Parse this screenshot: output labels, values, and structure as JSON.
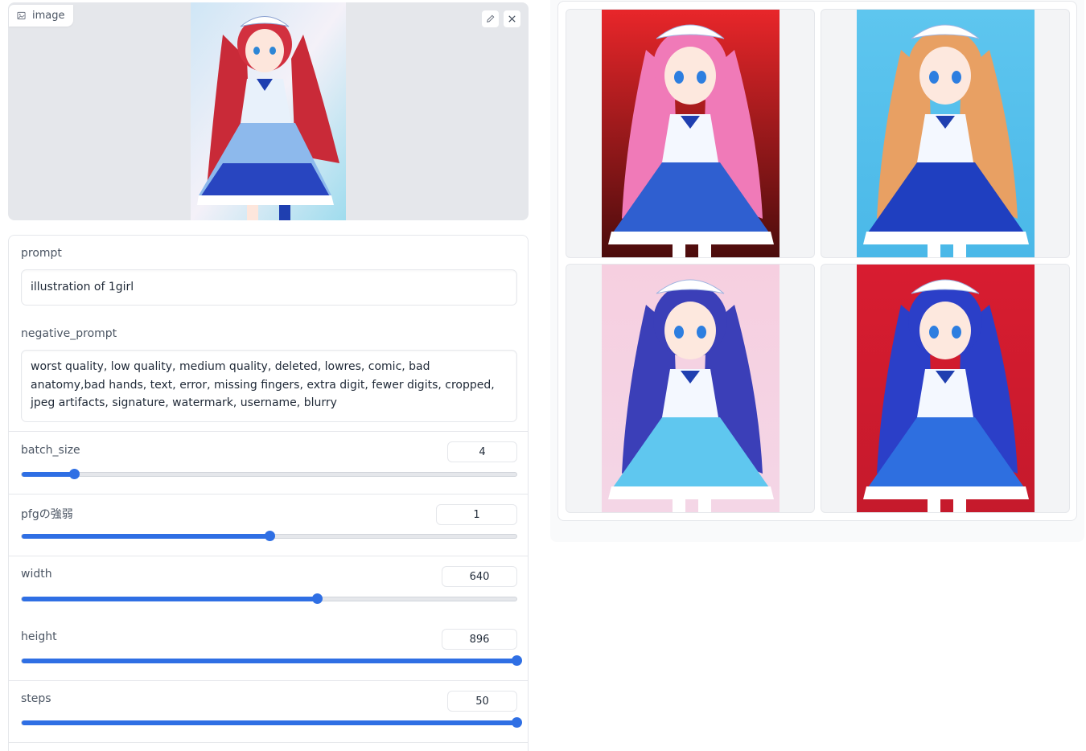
{
  "image_input": {
    "label": "image"
  },
  "form": {
    "prompt": {
      "label": "prompt",
      "value": "illustration of 1girl"
    },
    "negative_prompt": {
      "label": "negative_prompt",
      "value": "worst quality, low quality, medium quality, deleted, lowres, comic, bad anatomy,bad hands, text, error, missing fingers, extra digit, fewer digits, cropped, jpeg artifacts, signature, watermark, username, blurry"
    },
    "sliders": [
      {
        "label": "batch_size",
        "value": "4",
        "fraction": 0.105
      },
      {
        "label": "pfgの強弱",
        "value": "1",
        "fraction": 0.5
      },
      {
        "label": "width",
        "value": "640",
        "fraction": 0.597
      },
      {
        "label": "height",
        "value": "896",
        "fraction": 1.0
      },
      {
        "label": "steps",
        "value": "50",
        "fraction": 1.0
      }
    ]
  },
  "colors": {
    "accent": "#2f6fe4"
  },
  "gallery": {
    "items": [
      {
        "hair": "#f07ab8",
        "bg_top": "#e8262a",
        "bg_bottom": "#4a0c0c",
        "dress": "#2f5fd0"
      },
      {
        "hair": "#e8a063",
        "bg_top": "#5ec6ef",
        "bg_bottom": "#4ab8e8",
        "dress": "#1f3fc0"
      },
      {
        "hair": "#3b3fb8",
        "bg_top": "#f6cfe0",
        "bg_bottom": "#f4d6e6",
        "dress": "#5fc7ef"
      },
      {
        "hair": "#2b3fc8",
        "bg_top": "#d81c30",
        "bg_bottom": "#c51a2c",
        "dress": "#2e6fe0"
      }
    ]
  }
}
